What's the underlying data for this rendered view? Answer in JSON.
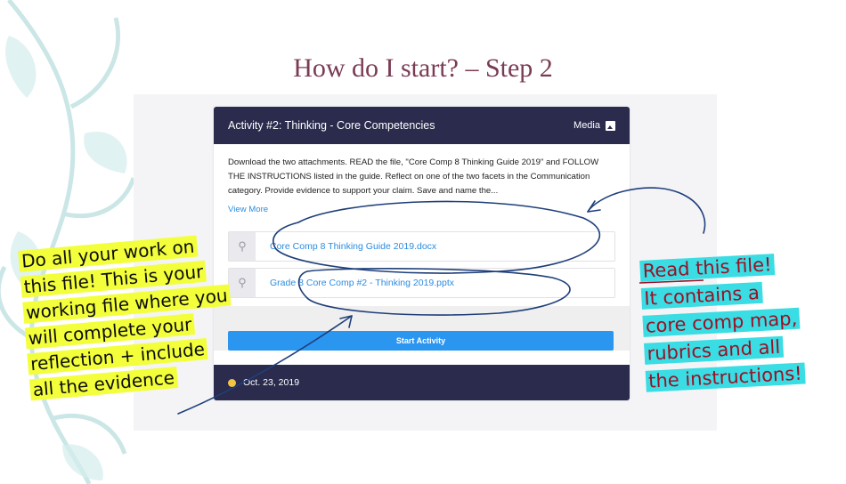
{
  "slide": {
    "title": "How do I start? – Step 2"
  },
  "activity": {
    "title": "Activity #2: Thinking - Core Competencies",
    "media_label": "Media",
    "media_icon": "image-icon",
    "description": "Download the two attachments.  READ the file, \"Core Comp 8 Thinking Guide 2019\" and FOLLOW THE INSTRUCTIONS listed in the guide.  Reflect on one of the two facets in the Communication category.  Provide evidence to support your claim.  Save and name the...",
    "view_more": "View More",
    "attachments": [
      {
        "name": "Core Comp 8 Thinking Guide 2019.docx",
        "icon": "paperclip-icon"
      },
      {
        "name": "Grade 8 Core Comp #2 - Thinking 2019.pptx",
        "icon": "paperclip-icon"
      }
    ],
    "start_button": "Start Activity",
    "date": "Oct. 23, 2019",
    "footer_icon": "apple-icon"
  },
  "annotations": {
    "left": [
      "Do all your work on",
      "this file! This is your",
      "working file where you",
      "will complete your",
      "reflection + include",
      "all the evidence"
    ],
    "right": [
      "Read this file!",
      "It contains a",
      "core comp map,",
      "rubrics and all",
      "the instructions!"
    ]
  },
  "colors": {
    "card_header": "#2a2b4d",
    "link": "#2b8ce0",
    "button": "#2b96f0",
    "title": "#7a3b55",
    "highlight_yellow": "#f2ff3a",
    "highlight_cyan": "#39dde3",
    "ink_red": "#9b1026",
    "ink_blue": "#1f3f7a"
  }
}
